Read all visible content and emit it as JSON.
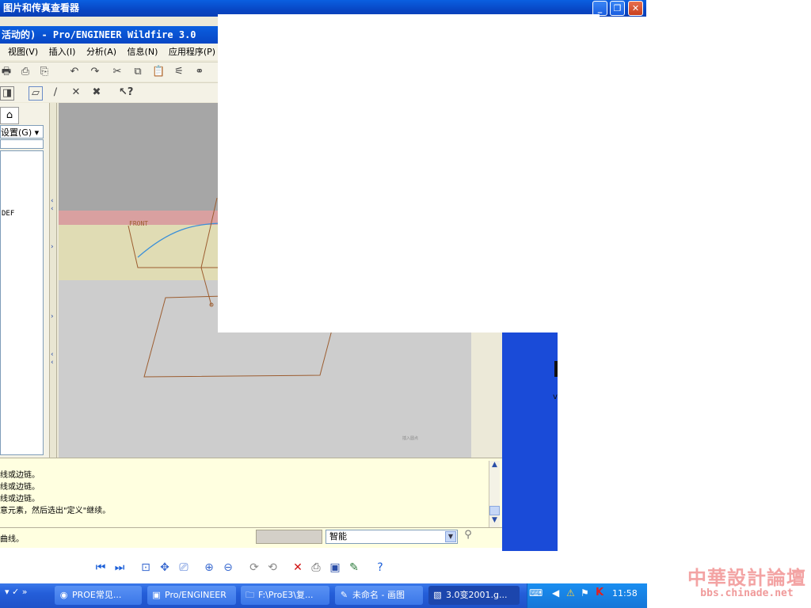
{
  "viewer": {
    "title": "图片和传真查看器",
    "controls": [
      "_",
      "❐",
      "✕"
    ]
  },
  "proe": {
    "title": "活动的) - Pro/ENGINEER Wildfire 3.0",
    "menu": [
      "视图(V)",
      "插入(I)",
      "分析(A)",
      "信息(N)",
      "应用程序(P)"
    ],
    "settings_label": "设置(G) ▾",
    "tree_item": "DEF",
    "datum_label": "FRONT",
    "watermark_small": "插入圆点",
    "messages": [
      "线或边链。",
      "线或边链。",
      "线或边链。",
      "意元素，然后选出\"定义\"继续。"
    ],
    "status_text": "曲线。",
    "filter_value": "智能"
  },
  "colors": {
    "titlebar": "#0a52d8",
    "proe_bg": "#ece9d8",
    "graphics_gray": "#cdcdcd",
    "plane_pink": "#d9a0a0",
    "plane_yellow": "#e0dcb4",
    "sketch_brown": "#9c5d30",
    "curve_blue": "#3a8fd8",
    "message_yellow": "#ffffe0",
    "desktop_blue": "#1a4bd8"
  },
  "taskbar": {
    "items": [
      {
        "label": "PROE常见...",
        "icon": "browser-icon"
      },
      {
        "label": "Pro/ENGINEER",
        "icon": "window-icon"
      },
      {
        "label": "F:\\ProE3\\复...",
        "icon": "folder-icon"
      },
      {
        "label": "未命名 - 画图",
        "icon": "paint-icon"
      },
      {
        "label": "3.0变2001.g...",
        "icon": "image-icon"
      }
    ],
    "clock": "11:58"
  },
  "watermark": {
    "title": "中華設計論壇",
    "url": "bbs.chinade.net"
  }
}
